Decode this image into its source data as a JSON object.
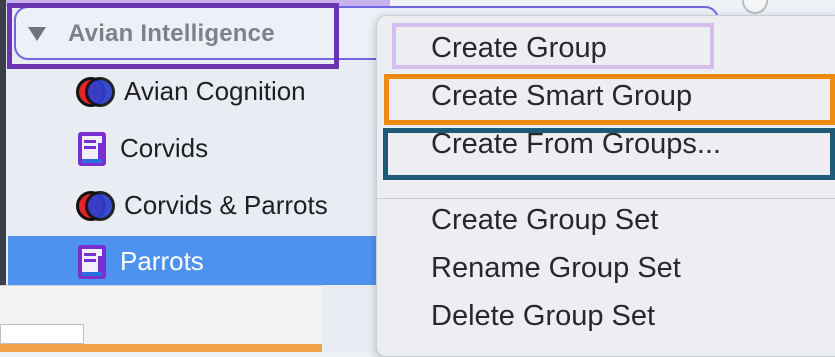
{
  "sidebar": {
    "header": {
      "label": "Avian Intelligence"
    },
    "items": [
      {
        "label": "Avian Cognition",
        "icon": "smart-group-icon"
      },
      {
        "label": "Corvids",
        "icon": "group-icon"
      },
      {
        "label": "Corvids & Parrots",
        "icon": "smart-group-icon"
      },
      {
        "label": "Parrots",
        "icon": "group-icon",
        "selected": true
      }
    ]
  },
  "context_menu": {
    "items": [
      "Create Group",
      "Create Smart Group",
      "Create From Groups...",
      "Create Group Set",
      "Rename Group Set",
      "Delete Group Set"
    ]
  },
  "colors": {
    "selection": "#4e92f0",
    "highlight_purple": "#6a35b0",
    "highlight_lavender": "#d4bfee",
    "highlight_orange": "#f08a10",
    "highlight_teal": "#1d5a78"
  }
}
